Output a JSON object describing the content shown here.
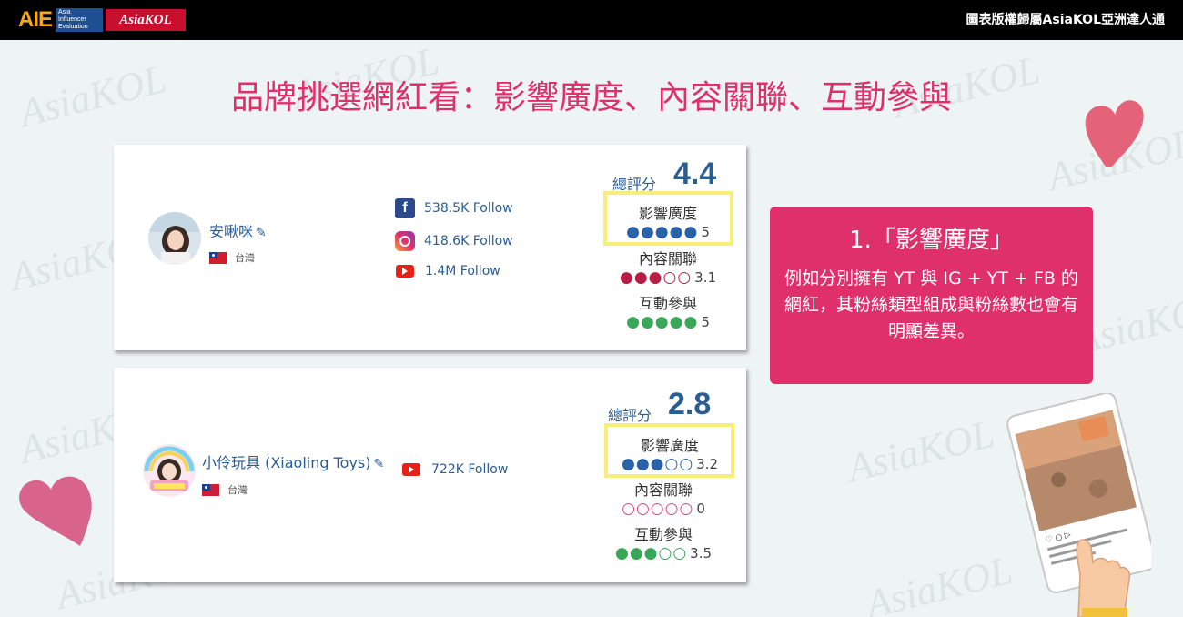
{
  "header": {
    "logo_aie": "AIE",
    "logo_aie_sub": "Asia Influencer Evaluation",
    "logo_kol": "AsiaKOL",
    "copyright": "圖表版權歸屬AsiaKOL亞洲達人通"
  },
  "title": "品牌挑選網紅看：影響廣度、內容關聯、互動參與",
  "labels": {
    "total": "總評分",
    "influence": "影響廣度",
    "relevance": "內容關聯",
    "engagement": "互動參與"
  },
  "influencers": [
    {
      "name": "安啾咪",
      "country": "台灣",
      "socials": [
        {
          "platform": "facebook",
          "followers": "538.5K Follow"
        },
        {
          "platform": "instagram",
          "followers": "418.6K Follow"
        },
        {
          "platform": "youtube",
          "followers": "1.4M Follow"
        }
      ],
      "total_score": "4.4",
      "influence": {
        "filled": 5,
        "value": "5"
      },
      "relevance": {
        "filled": 3,
        "value": "3.1"
      },
      "engagement": {
        "filled": 5,
        "value": "5"
      }
    },
    {
      "name": "小伶玩具 (Xiaoling Toys)",
      "country": "台灣",
      "socials": [
        {
          "platform": "youtube",
          "followers": "722K Follow"
        }
      ],
      "total_score": "2.8",
      "influence": {
        "filled": 3,
        "value": "3.2"
      },
      "relevance": {
        "filled": 0,
        "value": "0"
      },
      "engagement": {
        "filled": 3,
        "value": "3.5"
      }
    }
  ],
  "info": {
    "heading": "1.「影響廣度」",
    "body": "例如分別擁有 YT 與 IG + YT + FB 的網紅，其粉絲類型組成與粉絲數也會有明顯差異。"
  },
  "watermark": "AsiaKOL",
  "colors": {
    "accent": "#e0306b",
    "influence": "#2a62a8",
    "relevance": "#b81e45",
    "engagement": "#3aa657",
    "highlight": "#f7ef7a"
  }
}
